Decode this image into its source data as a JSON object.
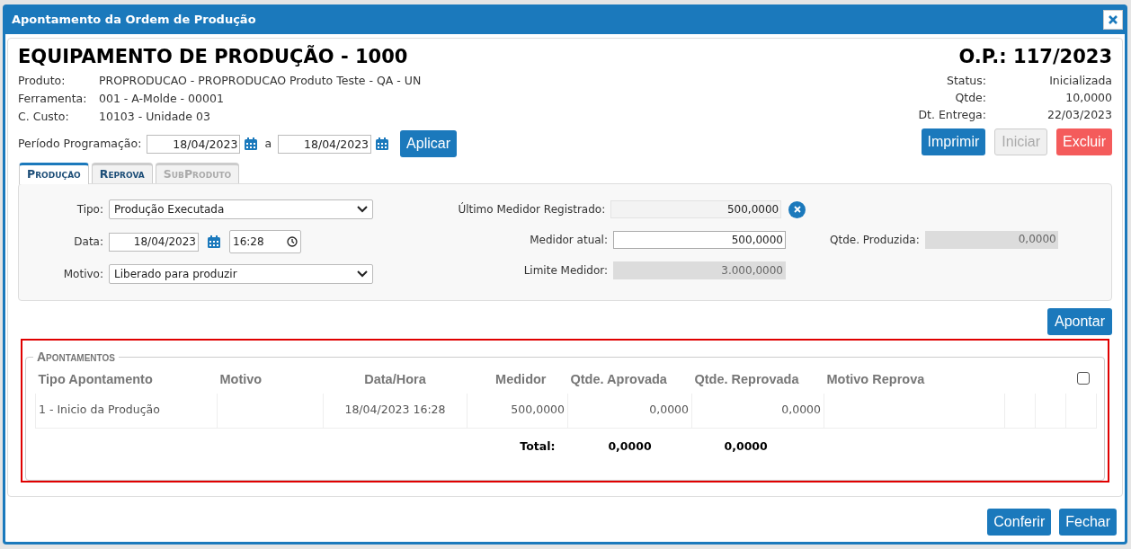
{
  "window": {
    "title": "Apontamento da Ordem de Produção"
  },
  "header": {
    "title": "EQUIPAMENTO DE PRODUÇÃO - 1000",
    "order": "O.P.: 117/2023",
    "info": [
      {
        "label": "Produto:",
        "value": "PROPRODUCAO - PROPRODUCAO Produto Teste - QA - UN"
      },
      {
        "label": "Ferramenta:",
        "value": "001 - A-Molde - 00001"
      },
      {
        "label": "C. Custo:",
        "value": "10103 - Unidade 03"
      }
    ],
    "status": [
      {
        "label": "Status:",
        "value": "Inicializada"
      },
      {
        "label": "Qtde:",
        "value": "10,0000"
      },
      {
        "label": "Dt. Entrega:",
        "value": "22/03/2023"
      }
    ]
  },
  "period": {
    "label": "Período Programação:",
    "from": "18/04/2023",
    "separator": "a",
    "to": "18/04/2023",
    "apply": "Aplicar"
  },
  "actions": [
    {
      "label": "Imprimir",
      "kind": "primary",
      "disabled": false
    },
    {
      "label": "Iniciar",
      "kind": "default",
      "disabled": true
    },
    {
      "label": "Excluir",
      "kind": "danger",
      "disabled": false
    }
  ],
  "tabs": [
    {
      "label": "Produção",
      "selected": true,
      "disabled": false
    },
    {
      "label": "Reprova",
      "selected": false,
      "disabled": false
    },
    {
      "label": "SubProduto",
      "selected": false,
      "disabled": true
    }
  ],
  "form": {
    "tipo": {
      "label": "Tipo:",
      "value": "Produção Executada"
    },
    "data": {
      "label": "Data:",
      "date": "18/04/2023",
      "time": "16:28"
    },
    "motivo": {
      "label": "Motivo:",
      "value": "Liberado para produzir"
    },
    "ultimo_medidor": {
      "label": "Último Medidor Registrado:",
      "value": "500,0000"
    },
    "medidor_atual": {
      "label": "Medidor atual:",
      "value": "500,0000"
    },
    "limite_medidor": {
      "label": "Limite Medidor:",
      "value": "3.000,0000"
    },
    "qtde_produzida": {
      "label": "Qtde. Produzida:",
      "value": "0,0000"
    }
  },
  "submit": "Apontar",
  "apontamentos": {
    "title": "Apontamentos",
    "highlighted": true,
    "columns": [
      "Tipo Apontamento",
      "Motivo",
      "Data/Hora",
      "Medidor",
      "Qtde. Aprovada",
      "Qtde. Reprovada",
      "Motivo Reprova"
    ],
    "select_all": {
      "checked": false
    },
    "rows": [
      {
        "cells": [
          "1 - Inicio da Produção",
          "",
          "18/04/2023 16:28",
          "500,0000",
          "0,0000",
          "0,0000",
          ""
        ]
      }
    ],
    "total": {
      "label": "Total:",
      "aprovada": "0,0000",
      "reprovada": "0,0000"
    }
  },
  "footer_buttons": [
    "Conferir",
    "Fechar"
  ]
}
